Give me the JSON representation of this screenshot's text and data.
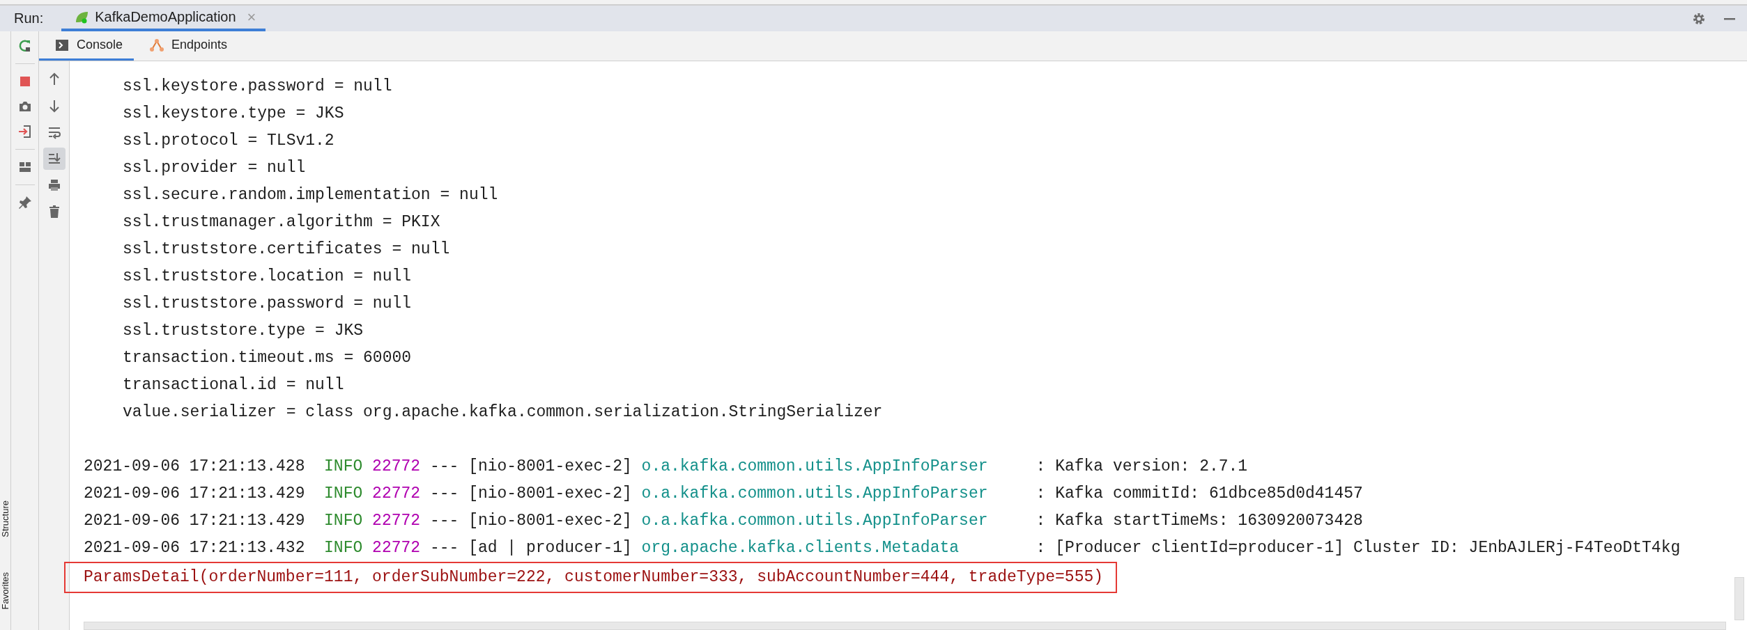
{
  "run_bar": {
    "label": "Run:",
    "tabs": [
      {
        "title": "KafkaDemoApplication",
        "close": "×",
        "selected": true
      }
    ]
  },
  "side_strip": [
    "Structure",
    "Favorites"
  ],
  "console_tabs": [
    {
      "label": "Console",
      "kind": "console",
      "selected": true
    },
    {
      "label": "Endpoints",
      "kind": "endpoints",
      "selected": false
    }
  ],
  "console_toolbar": {
    "scroll_to_end_on": true
  },
  "console": {
    "config_lines": [
      "ssl.keystore.password = null",
      "ssl.keystore.type = JKS",
      "ssl.protocol = TLSv1.2",
      "ssl.provider = null",
      "ssl.secure.random.implementation = null",
      "ssl.trustmanager.algorithm = PKIX",
      "ssl.truststore.certificates = null",
      "ssl.truststore.location = null",
      "ssl.truststore.password = null",
      "ssl.truststore.type = JKS",
      "transaction.timeout.ms = 60000",
      "transactional.id = null",
      "value.serializer = class org.apache.kafka.common.serialization.StringSerializer"
    ],
    "log_lines": [
      {
        "timestamp": "2021-09-06 17:21:13.428",
        "level": "INFO",
        "pid": "22772",
        "separator": "---",
        "thread": "[nio-8001-exec-2]",
        "logger": "o.a.kafka.common.utils.AppInfoParser",
        "colon": ":",
        "message": "Kafka version: 2.7.1"
      },
      {
        "timestamp": "2021-09-06 17:21:13.429",
        "level": "INFO",
        "pid": "22772",
        "separator": "---",
        "thread": "[nio-8001-exec-2]",
        "logger": "o.a.kafka.common.utils.AppInfoParser",
        "colon": ":",
        "message": "Kafka commitId: 61dbce85d0d41457"
      },
      {
        "timestamp": "2021-09-06 17:21:13.429",
        "level": "INFO",
        "pid": "22772",
        "separator": "---",
        "thread": "[nio-8001-exec-2]",
        "logger": "o.a.kafka.common.utils.AppInfoParser",
        "colon": ":",
        "message": "Kafka startTimeMs: 1630920073428"
      },
      {
        "timestamp": "2021-09-06 17:21:13.432",
        "level": "INFO",
        "pid": "22772",
        "separator": "---",
        "thread": "[ad | producer-1]",
        "logger": "org.apache.kafka.clients.Metadata",
        "colon": ":",
        "message": "[Producer clientId=producer-1] Cluster ID: JEnbAJLERj-F4TeoDtT4kg"
      }
    ],
    "output_lines": [
      {
        "text": "ParamsDetail(orderNumber=111, orderSubNumber=222, customerNumber=333, subAccountNumber=444, tradeType=555)",
        "highlighted": true
      }
    ]
  }
}
